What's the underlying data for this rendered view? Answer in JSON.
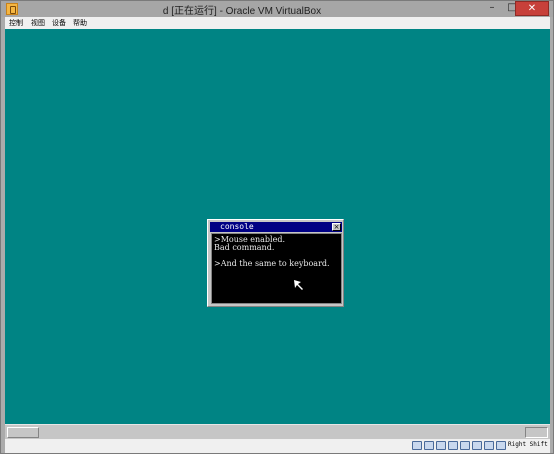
{
  "window": {
    "title": "d [正在运行] - Oracle VM VirtualBox",
    "min_label": "–",
    "max_label": "□",
    "close_label": "✕"
  },
  "menubar": {
    "items": [
      "控制",
      "视图",
      "设备",
      "帮助"
    ]
  },
  "guest": {
    "desktop_color": "#008484",
    "console": {
      "title": "console",
      "close_label": "×",
      "lines": [
        ">Mouse enabled.",
        "Bad command.",
        "",
        ">And the same to keyboard."
      ]
    }
  },
  "statusbar": {
    "icons": [
      "hard-disk-icon",
      "optical-drive-icon",
      "usb-icon",
      "shared-folder-icon",
      "display-icon",
      "network-icon",
      "capture-icon",
      "mouse-integration-icon"
    ],
    "host_key": "Right Shift"
  }
}
